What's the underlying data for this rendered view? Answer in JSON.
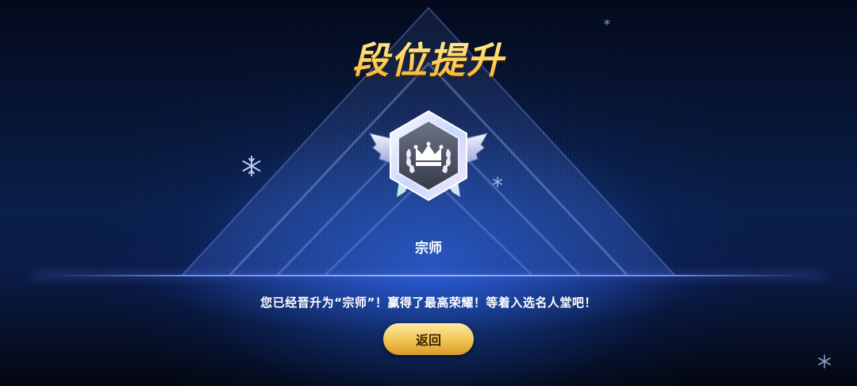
{
  "header": {
    "title": "段位提升"
  },
  "badge": {
    "icon": "crown-laurel-badge-icon",
    "rank_name": "宗师"
  },
  "message": "您已经晋升为“宗师”！赢得了最高荣耀！等着入选名人堂吧！",
  "actions": {
    "back_label": "返回"
  },
  "decorations": [
    "snowflake-icon",
    "snowflake-icon",
    "snowflake-icon",
    "snowflake-icon"
  ],
  "colors": {
    "accent_gold": "#f2c453",
    "title_gold": "#ffd35a",
    "glow_blue": "#6f8bff"
  }
}
